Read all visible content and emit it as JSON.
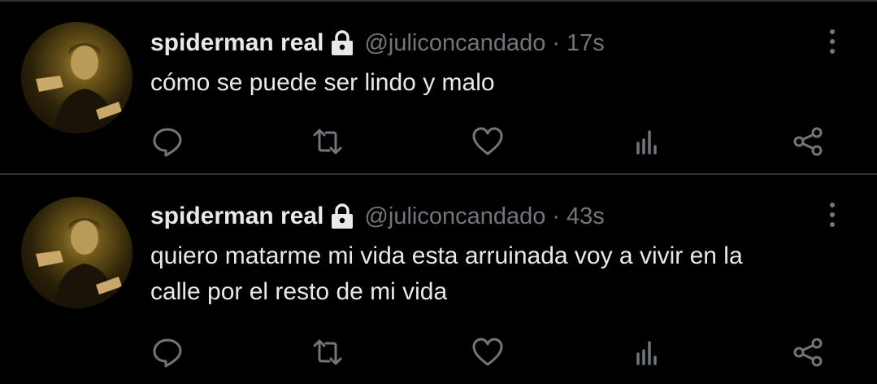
{
  "tweets": [
    {
      "display_name": "spiderman real",
      "handle": "@juliconcandado",
      "separator": "·",
      "time": "17s",
      "text_lines": [
        "cómo se puede ser lindo y malo"
      ]
    },
    {
      "display_name": "spiderman real",
      "handle": "@juliconcandado",
      "separator": "·",
      "time": "43s",
      "text_lines": [
        "quiero matarme mi vida esta arruinada voy a vivir en la",
        "calle por el resto de mi vida"
      ]
    }
  ],
  "icons": {
    "lock": "lock-icon",
    "more": "more-vertical-icon",
    "reply": "reply-icon",
    "retweet": "retweet-icon",
    "like": "heart-icon",
    "views": "analytics-icon",
    "share": "share-icon"
  },
  "colors": {
    "background": "#000000",
    "primary_text": "#e7e9ea",
    "secondary_text": "#71767b",
    "divider": "#2f3336"
  }
}
